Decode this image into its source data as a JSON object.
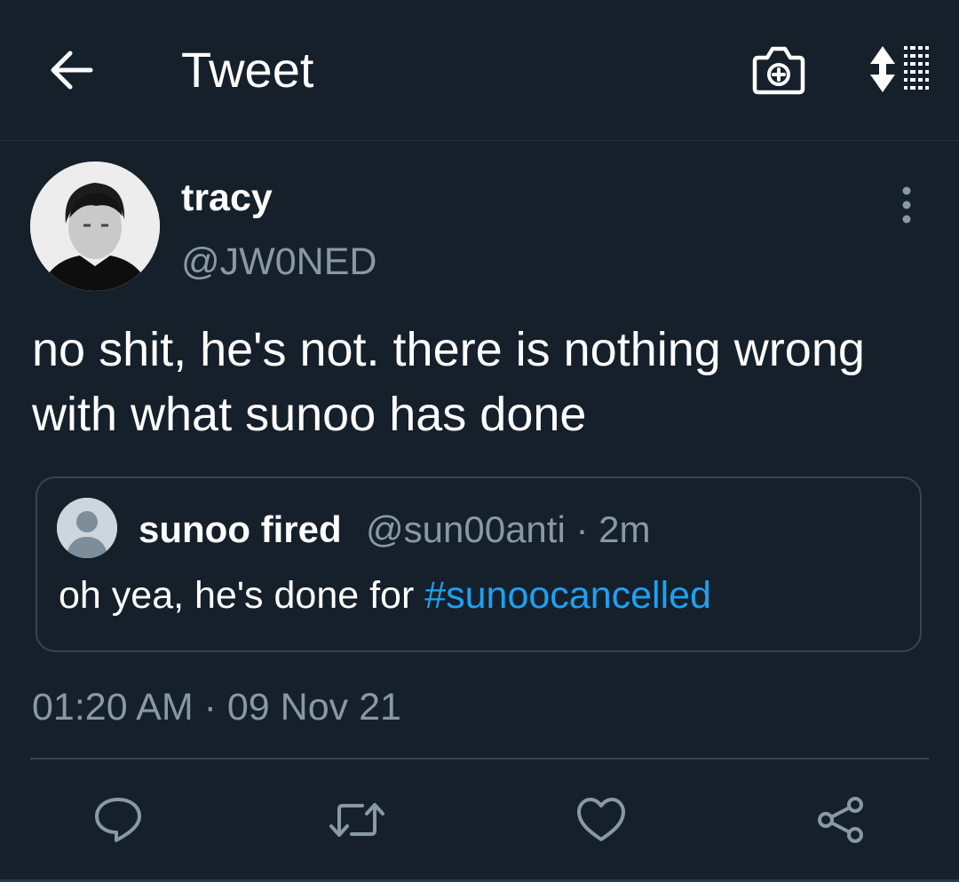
{
  "header": {
    "title": "Tweet",
    "back_icon": "arrow-left-icon",
    "camera_icon": "camera-plus-icon",
    "sort_icon": "sort-list-icon"
  },
  "tweet": {
    "author": {
      "display_name": "tracy",
      "handle": "@JW0NED"
    },
    "text": "no shit, he's not. there is nothing wrong with what sunoo has done",
    "timestamp": "01:20 AM · 09 Nov 21"
  },
  "quoted_tweet": {
    "author_name": "sunoo fired",
    "handle": "@sun00anti",
    "age": "· 2m",
    "text_prefix": "oh yea, he's done for ",
    "hashtag": "#sunoocancelled"
  },
  "actions": {
    "reply_icon": "reply-icon",
    "retweet_icon": "retweet-icon",
    "like_icon": "heart-icon",
    "share_icon": "share-icon"
  },
  "colors": {
    "background": "#15202b",
    "secondary_text": "#8899a6",
    "accent": "#1da1f2",
    "border": "#38444d"
  }
}
